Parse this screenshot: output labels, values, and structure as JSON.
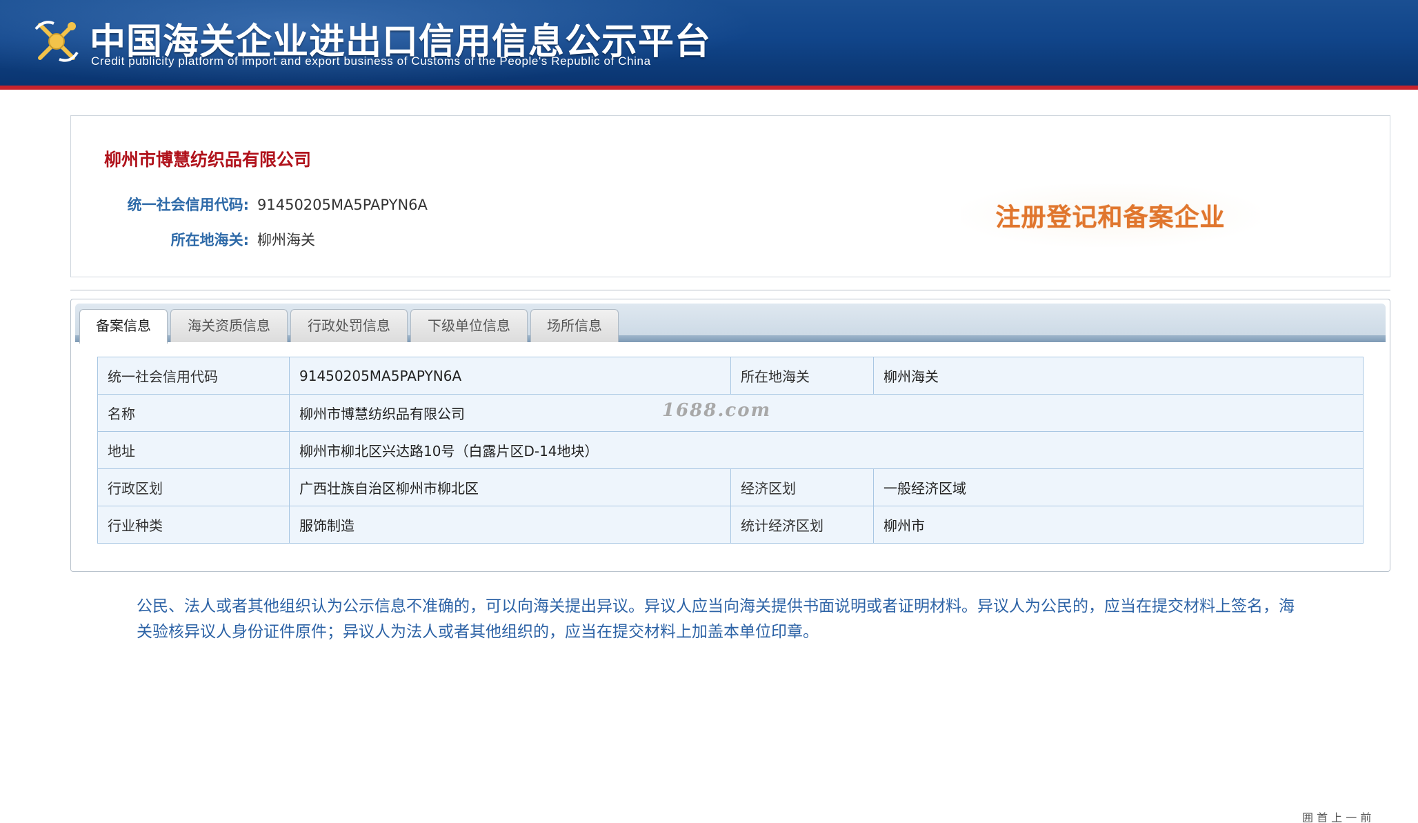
{
  "header": {
    "title_cn": "中国海关企业进出口信用信息公示平台",
    "title_en": "Credit publicity platform of import and export business of Customs of the People's Republic of China",
    "emblem_icon": "customs-emblem-icon"
  },
  "company": {
    "name": "柳州市博慧纺织品有限公司",
    "credit_code_label": "统一社会信用代码:",
    "credit_code": "91450205MA5PAPYN6A",
    "customs_label": "所在地海关:",
    "customs": "柳州海关",
    "status_stamp": "注册登记和备案企业"
  },
  "tabs": [
    {
      "label": "备案信息",
      "active": true
    },
    {
      "label": "海关资质信息",
      "active": false
    },
    {
      "label": "行政处罚信息",
      "active": false
    },
    {
      "label": "下级单位信息",
      "active": false
    },
    {
      "label": "场所信息",
      "active": false
    }
  ],
  "table": {
    "r1": {
      "l1": "统一社会信用代码",
      "v1": "91450205MA5PAPYN6A",
      "l2": "所在地海关",
      "v2": "柳州海关"
    },
    "r2": {
      "l1": "名称",
      "v1": "柳州市博慧纺织品有限公司"
    },
    "r3": {
      "l1": "地址",
      "v1": "柳州市柳北区兴达路10号（白露片区D-14地块）"
    },
    "r4": {
      "l1": "行政区划",
      "v1": "广西壮族自治区柳州市柳北区",
      "l2": "经济区划",
      "v2": "一般经济区域"
    },
    "r5": {
      "l1": "行业种类",
      "v1": "服饰制造",
      "l2": "统计经济区划",
      "v2": "柳州市"
    }
  },
  "watermark": "1688.com",
  "notice": "公民、法人或者其他组织认为公示信息不准确的，可以向海关提出异议。异议人应当向海关提供书面说明或者证明材料。异议人为公民的，应当在提交材料上签名，海关验核异议人身份证件原件；异议人为法人或者其他组织的，应当在提交材料上加盖本单位印章。",
  "corner_text": "囲 首 上 一 前",
  "colors": {
    "header_blue": "#11458a",
    "header_red_line": "#c8232c",
    "company_name_red": "#b0121b",
    "label_blue": "#2e6aa8",
    "notice_blue": "#2d63a6",
    "table_bg": "#eef5fc",
    "table_border": "#a9c7e3",
    "stamp_orange": "#e0762e"
  }
}
